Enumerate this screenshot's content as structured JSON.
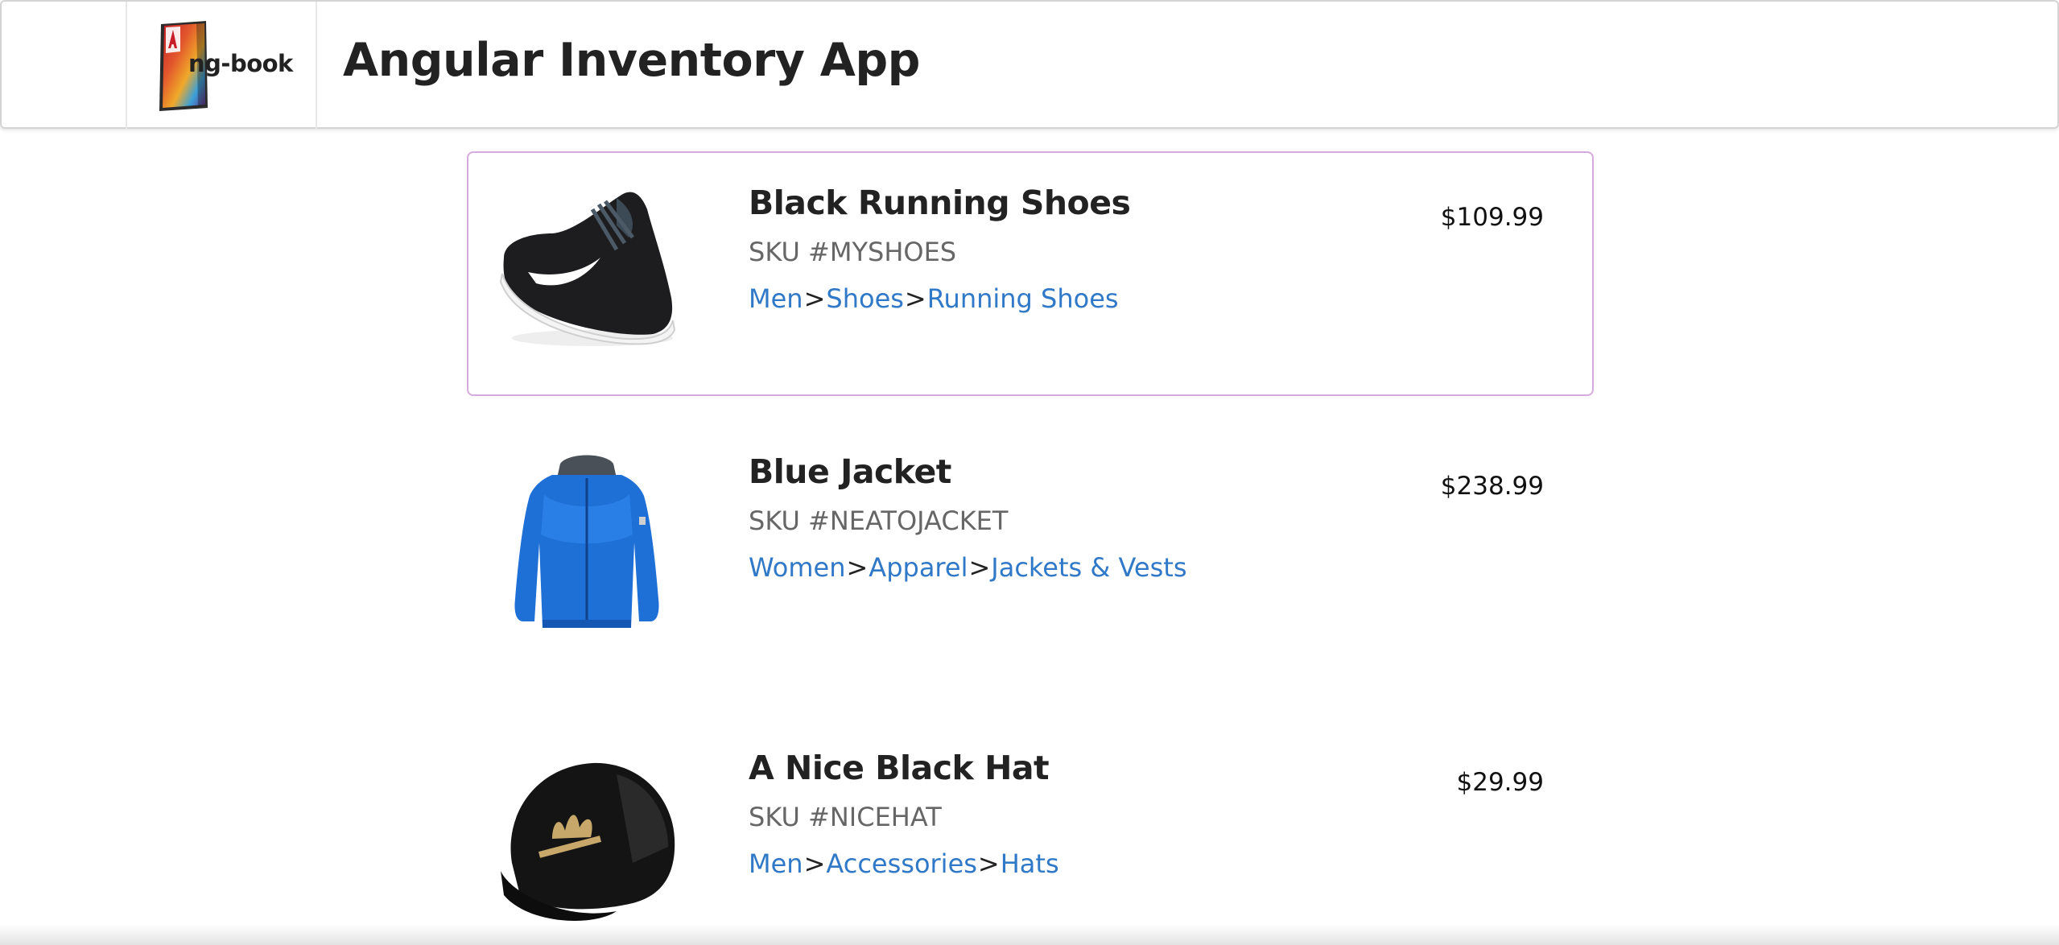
{
  "header": {
    "logo_text": "ng-book",
    "title": "Angular Inventory App"
  },
  "colors": {
    "link": "#2f79c8",
    "selected_border": "#d6a9df",
    "text": "#222222",
    "muted": "#666666"
  },
  "products": [
    {
      "name": "Black Running Shoes",
      "sku": "SKU #MYSHOES",
      "price": "$109.99",
      "selected": true,
      "image_icon": "running-shoe-icon",
      "department": [
        "Men",
        "Shoes",
        "Running Shoes"
      ]
    },
    {
      "name": "Blue Jacket",
      "sku": "SKU #NEATOJACKET",
      "price": "$238.99",
      "selected": false,
      "image_icon": "jacket-icon",
      "department": [
        "Women",
        "Apparel",
        "Jackets & Vests"
      ]
    },
    {
      "name": "A Nice Black Hat",
      "sku": "SKU #NICEHAT",
      "price": "$29.99",
      "selected": false,
      "image_icon": "cap-icon",
      "department": [
        "Men",
        "Accessories",
        "Hats"
      ]
    }
  ],
  "breadcrumb_separator": ">"
}
